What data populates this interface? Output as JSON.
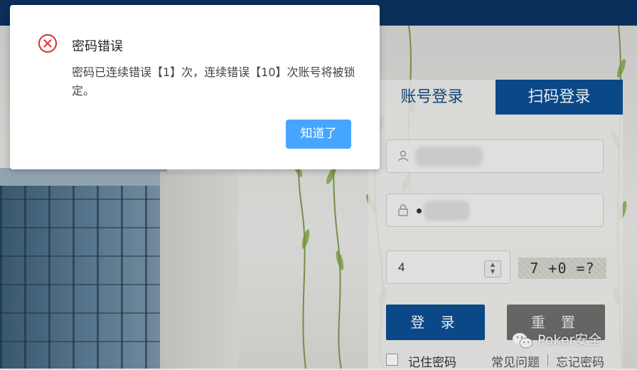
{
  "login": {
    "tabs": [
      {
        "label": "账号登录",
        "active": true
      },
      {
        "label": "扫码登录",
        "active": false
      }
    ],
    "captcha": {
      "value": "4",
      "image_text": "7 +0 =?"
    },
    "login_button": "登 录",
    "reset_button": "重 置",
    "remember_label": "记住密码",
    "faq_link": "常见问题",
    "forgot_link": "忘记密码"
  },
  "modal": {
    "title": "密码错误",
    "message": "密码已连续错误【1】次，连续错误【10】次账号将被锁定。",
    "confirm_button": "知道了",
    "icon": "error-circle-icon"
  },
  "watermark": {
    "text": "Poker安全",
    "icon": "wechat-icon"
  },
  "colors": {
    "topbar": "#0b3463",
    "primary": "#0b4f93",
    "modal_button": "#46a6ff",
    "error": "#e0393e"
  }
}
